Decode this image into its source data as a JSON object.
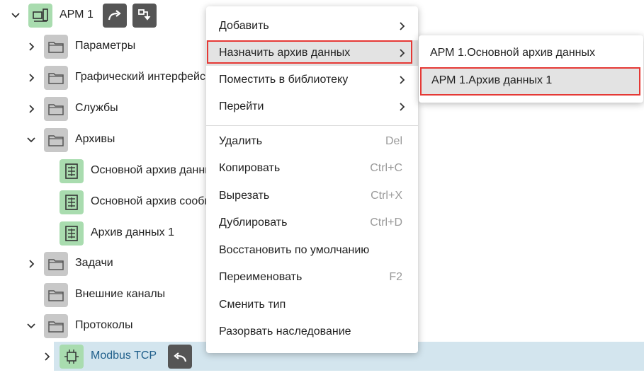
{
  "tree": {
    "root": {
      "label": "АРМ 1"
    },
    "items": [
      {
        "label": "Параметры"
      },
      {
        "label": "Графический интерфейс"
      },
      {
        "label": "Службы"
      },
      {
        "label": "Архивы"
      },
      {
        "label": "Основной архив данных"
      },
      {
        "label": "Основной архив сообщений"
      },
      {
        "label": "Архив данных 1"
      },
      {
        "label": "Задачи"
      },
      {
        "label": "Внешние каналы"
      },
      {
        "label": "Протоколы"
      },
      {
        "label": "Modbus TCP"
      }
    ],
    "selected_color": "#d3e5ee",
    "link_color": "#1f5f8b"
  },
  "context_menu": {
    "items": [
      {
        "label": "Добавить"
      },
      {
        "label": "Назначить архив данных"
      },
      {
        "label": "Поместить в библиотеку"
      },
      {
        "label": "Перейти"
      },
      {
        "label": "Удалить",
        "shortcut": "Del"
      },
      {
        "label": "Копировать",
        "shortcut": "Ctrl+C"
      },
      {
        "label": "Вырезать",
        "shortcut": "Ctrl+X"
      },
      {
        "label": "Дублировать",
        "shortcut": "Ctrl+D"
      },
      {
        "label": "Восстановить по умолчанию"
      },
      {
        "label": "Переименовать",
        "shortcut": "F2"
      },
      {
        "label": "Сменить тип"
      },
      {
        "label": "Разорвать наследование"
      }
    ],
    "highlight_color": "#e53935"
  },
  "submenu": {
    "items": [
      {
        "label": "АРМ 1.Основной архив данных"
      },
      {
        "label": "АРМ 1.Архив данных 1"
      }
    ]
  }
}
